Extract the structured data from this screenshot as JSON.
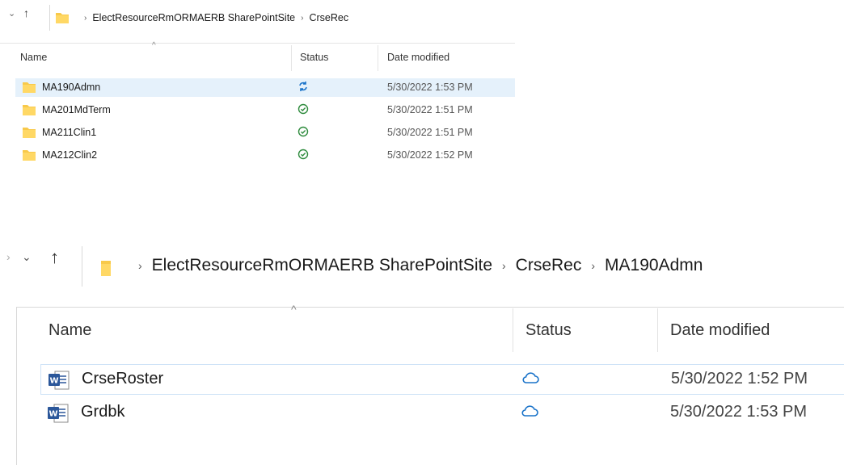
{
  "top_window": {
    "breadcrumb": [
      "ElectResourceRmORMAERB SharePointSite",
      "CrseRec"
    ],
    "columns": {
      "name": "Name",
      "status": "Status",
      "date": "Date modified"
    },
    "rows": [
      {
        "name": "MA190Admn",
        "status": "syncing",
        "date": "5/30/2022 1:53 PM",
        "selected": true
      },
      {
        "name": "MA201MdTerm",
        "status": "available",
        "date": "5/30/2022 1:51 PM"
      },
      {
        "name": "MA211Clin1",
        "status": "available",
        "date": "5/30/2022 1:51 PM"
      },
      {
        "name": "MA212Clin2",
        "status": "available",
        "date": "5/30/2022 1:52 PM"
      }
    ]
  },
  "bottom_window": {
    "breadcrumb": [
      "ElectResourceRmORMAERB SharePointSite",
      "CrseRec",
      "MA190Admn"
    ],
    "columns": {
      "name": "Name",
      "status": "Status",
      "date": "Date modified"
    },
    "rows": [
      {
        "name": "CrseRoster",
        "status": "cloud-only",
        "date": "5/30/2022 1:52 PM",
        "selected": true
      },
      {
        "name": "Grdbk",
        "status": "cloud-only",
        "date": "5/30/2022 1:53 PM"
      }
    ]
  },
  "icons": {
    "folder": "folder-icon",
    "word": "word-document-icon",
    "syncing": "sync-icon",
    "available": "check-circle-icon",
    "cloud": "cloud-icon"
  },
  "colors": {
    "folder": "#f8c94a",
    "selected_row": "#e5f1fb",
    "sync_blue": "#1a73c9",
    "ok_green": "#2e8b3d",
    "word_blue": "#2b579a"
  }
}
